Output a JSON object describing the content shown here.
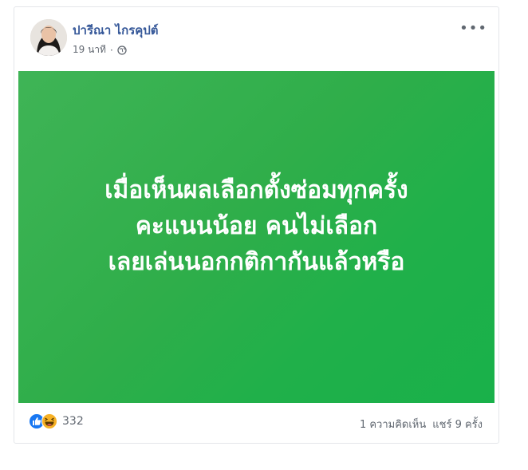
{
  "post": {
    "author": "ปารีณา ไกรคุปต์",
    "time": "19 นาที",
    "separator": "·",
    "privacy_icon": "globe-icon",
    "more_icon": "more-options-icon",
    "more_label": "•••"
  },
  "image": {
    "background_color": "#2fae4a",
    "lines": [
      "เมื่อเห็นผลเลือกตั้งซ่อมทุกครั้ง",
      "คะแนนน้อย คนไม่เลือก",
      "เลยเล่นนอกกติกากันแล้วหรือ"
    ]
  },
  "footer": {
    "reaction_icons": [
      "like-icon",
      "haha-icon"
    ],
    "reaction_count": "332",
    "comments": "1 ความคิดเห็น",
    "shares": "แชร์ 9 ครั้ง"
  },
  "colors": {
    "author": "#365899",
    "like": "#1877f2",
    "haha": "#f7b125"
  }
}
